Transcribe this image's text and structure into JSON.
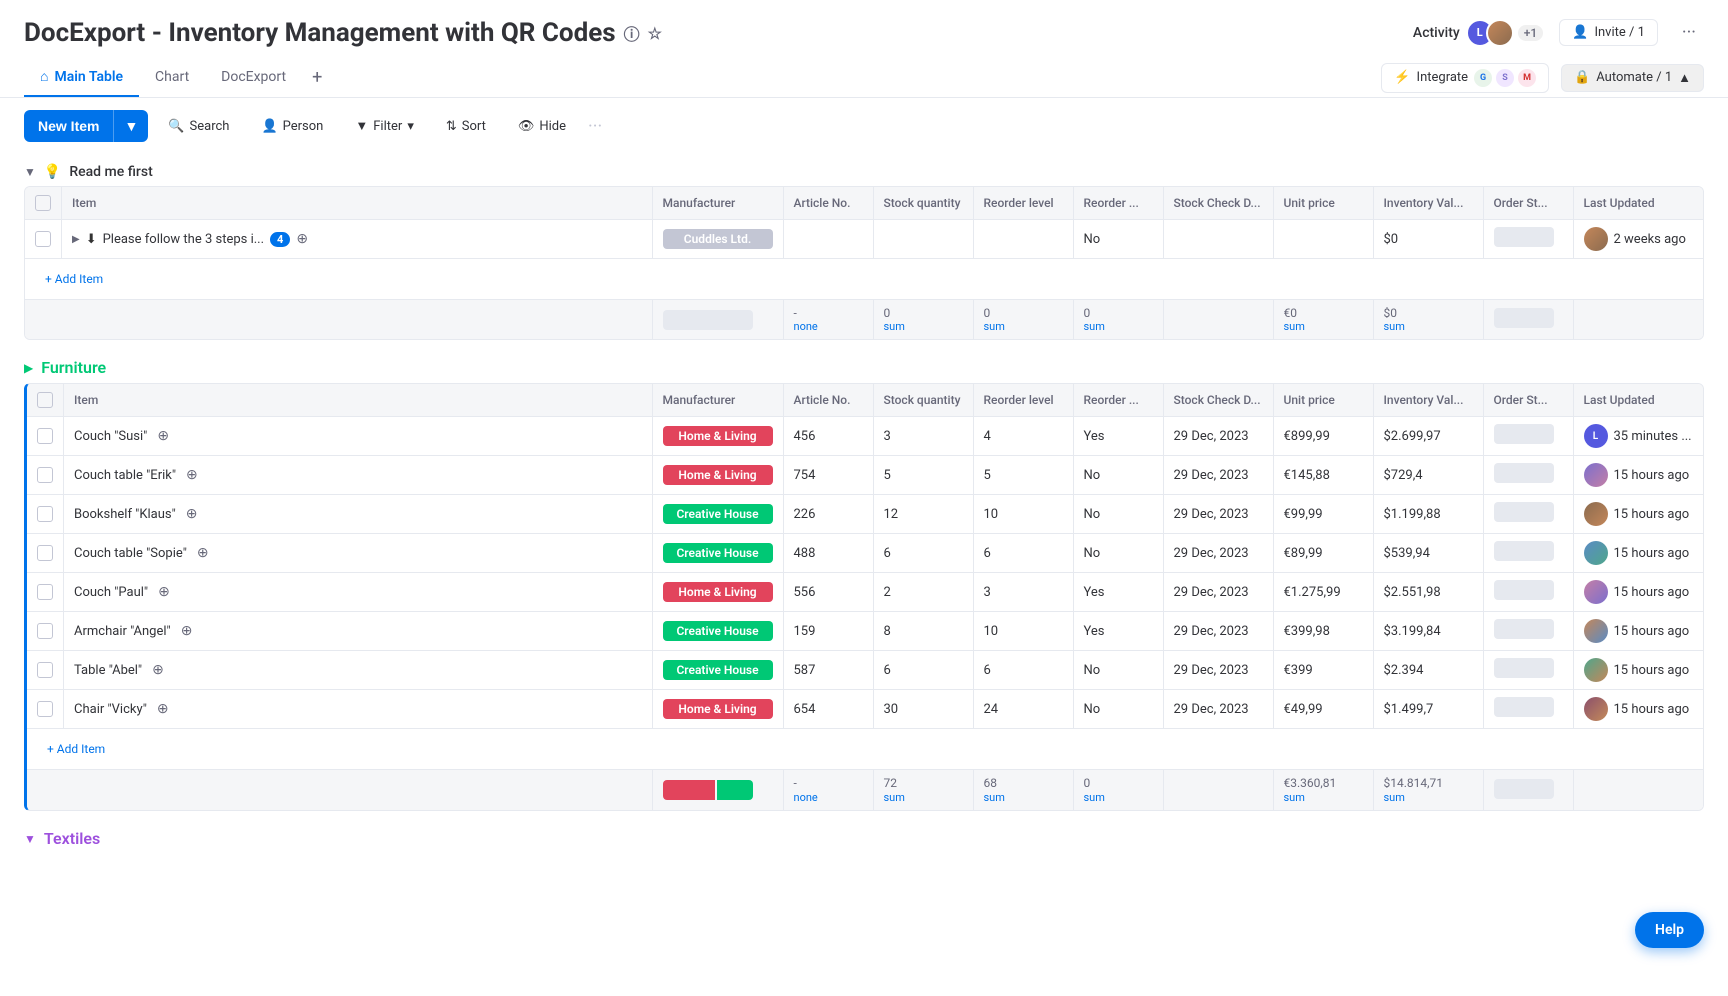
{
  "app": {
    "title": "DocExport - Inventory Management with QR Codes",
    "tabs": [
      {
        "label": "Main Table",
        "active": true,
        "icon": "home"
      },
      {
        "label": "Chart",
        "active": false
      },
      {
        "label": "DocExport",
        "active": false
      }
    ]
  },
  "header": {
    "activity_label": "Activity",
    "avatars_extra": "+1",
    "invite_label": "Invite / 1",
    "integrate_label": "Integrate",
    "automate_label": "Automate / 1"
  },
  "toolbar": {
    "new_item_label": "New Item",
    "search_label": "Search",
    "person_label": "Person",
    "filter_label": "Filter",
    "sort_label": "Sort",
    "hide_label": "Hide"
  },
  "sections": {
    "read_me": {
      "title": "Read me first",
      "icon": "💡",
      "columns": [
        "Item",
        "Manufacturer",
        "Article No.",
        "Stock quantity",
        "Reorder level",
        "Reorder ...",
        "Stock Check D...",
        "Unit price",
        "Inventory Val...",
        "Order St...",
        "Last Updated"
      ],
      "rows": [
        {
          "item": "Please follow the 3 steps i...",
          "item_badge": "4",
          "manufacturer": "Cuddles Ltd.",
          "manufacturer_color": "gray",
          "article": "",
          "stock": "",
          "reorder_level": "",
          "reorder": "No",
          "stock_check": "",
          "unit_price": "",
          "inventory_val": "$0",
          "order_status": "",
          "last_updated": "2 weeks ago",
          "avatar": "img"
        }
      ],
      "footer": {
        "stock_sum": "0",
        "reorder_sum": "0",
        "reorder2_sum": "0",
        "unit_sum": "€0",
        "inventory_sum": "$0"
      }
    },
    "furniture": {
      "title": "Furniture",
      "color": "teal",
      "columns": [
        "Item",
        "Manufacturer",
        "Article No.",
        "Stock quantity",
        "Reorder level",
        "Reorder ...",
        "Stock Check D...",
        "Unit price",
        "Inventory Val...",
        "Order St...",
        "Last Updated"
      ],
      "rows": [
        {
          "item": "Couch \"Susi\"",
          "manufacturer": "Home & Living",
          "manufacturer_color": "red",
          "article": "456",
          "stock": "3",
          "reorder_level": "4",
          "reorder": "Yes",
          "stock_check": "29 Dec, 2023",
          "unit_price": "€899,99",
          "inventory_val": "$2.699,97",
          "order_status": "",
          "last_updated": "35 minutes ...",
          "avatar": "l"
        },
        {
          "item": "Couch table \"Erik\"",
          "manufacturer": "Home & Living",
          "manufacturer_color": "red",
          "article": "754",
          "stock": "5",
          "reorder_level": "5",
          "reorder": "No",
          "stock_check": "29 Dec, 2023",
          "unit_price": "€145,88",
          "inventory_val": "$729,4",
          "order_status": "",
          "last_updated": "15 hours ago",
          "avatar": "img2"
        },
        {
          "item": "Bookshelf \"Klaus\"",
          "manufacturer": "Creative House",
          "manufacturer_color": "green",
          "article": "226",
          "stock": "12",
          "reorder_level": "10",
          "reorder": "No",
          "stock_check": "29 Dec, 2023",
          "unit_price": "€99,99",
          "inventory_val": "$1.199,88",
          "order_status": "",
          "last_updated": "15 hours ago",
          "avatar": "img3"
        },
        {
          "item": "Couch table \"Sopie\"",
          "manufacturer": "Creative House",
          "manufacturer_color": "green",
          "article": "488",
          "stock": "6",
          "reorder_level": "6",
          "reorder": "No",
          "stock_check": "29 Dec, 2023",
          "unit_price": "€89,99",
          "inventory_val": "$539,94",
          "order_status": "",
          "last_updated": "15 hours ago",
          "avatar": "img4"
        },
        {
          "item": "Couch \"Paul\"",
          "manufacturer": "Home & Living",
          "manufacturer_color": "red",
          "article": "556",
          "stock": "2",
          "reorder_level": "3",
          "reorder": "Yes",
          "stock_check": "29 Dec, 2023",
          "unit_price": "€1.275,99",
          "inventory_val": "$2.551,98",
          "order_status": "",
          "last_updated": "15 hours ago",
          "avatar": "img5"
        },
        {
          "item": "Armchair \"Angel\"",
          "manufacturer": "Creative House",
          "manufacturer_color": "green",
          "article": "159",
          "stock": "8",
          "reorder_level": "10",
          "reorder": "Yes",
          "stock_check": "29 Dec, 2023",
          "unit_price": "€399,98",
          "inventory_val": "$3.199,84",
          "order_status": "",
          "last_updated": "15 hours ago",
          "avatar": "img6"
        },
        {
          "item": "Table \"Abel\"",
          "manufacturer": "Creative House",
          "manufacturer_color": "green",
          "article": "587",
          "stock": "6",
          "reorder_level": "6",
          "reorder": "No",
          "stock_check": "29 Dec, 2023",
          "unit_price": "€399",
          "inventory_val": "$2.394",
          "order_status": "",
          "last_updated": "15 hours ago",
          "avatar": "img7"
        },
        {
          "item": "Chair \"Vicky\"",
          "manufacturer": "Home & Living",
          "manufacturer_color": "red",
          "article": "654",
          "stock": "30",
          "reorder_level": "24",
          "reorder": "No",
          "stock_check": "29 Dec, 2023",
          "unit_price": "€49,99",
          "inventory_val": "$1.499,7",
          "order_status": "",
          "last_updated": "15 hours ago",
          "avatar": "img8"
        }
      ],
      "footer": {
        "stock_sum": "72",
        "reorder_sum": "68",
        "reorder2_sum": "0",
        "unit_sum": "€3.360,81",
        "inventory_sum": "$14.814,71"
      }
    },
    "textiles": {
      "title": "Textiles",
      "color": "purple"
    }
  },
  "labels": {
    "add_item": "+ Add Item",
    "none": "none",
    "sum": "sum",
    "help": "Help"
  }
}
